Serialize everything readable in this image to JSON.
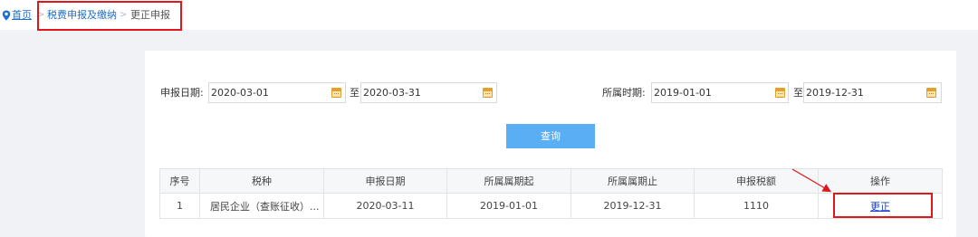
{
  "breadcrumb": {
    "home": "首页",
    "separator": ">",
    "section": "税费申报及缴纳",
    "current": "更正申报"
  },
  "filters": {
    "declare_date_label": "申报日期:",
    "declare_date_from": "2020-03-01",
    "declare_date_to": "2020-03-31",
    "to_label": "至",
    "period_label": "所属时期:",
    "period_from": "2019-01-01",
    "period_to": "2019-12-31"
  },
  "query_button": "查询",
  "table": {
    "headers": [
      "序号",
      "税种",
      "申报日期",
      "所属属期起",
      "所属属期止",
      "申报税额",
      "操作"
    ],
    "rows": [
      {
        "index": "1",
        "tax_type": "居民企业（查账征收）...",
        "declare_date": "2020-03-11",
        "period_start": "2019-01-01",
        "period_end": "2019-12-31",
        "amount": "1110",
        "action": "更正"
      }
    ]
  },
  "colors": {
    "accent_blue": "#5aaef4",
    "link_blue": "#1a6fd1",
    "highlight_red": "#e0161d",
    "calendar_orange": "#e2a12a"
  },
  "icons": [
    "location-pin-icon",
    "calendar-icon"
  ]
}
